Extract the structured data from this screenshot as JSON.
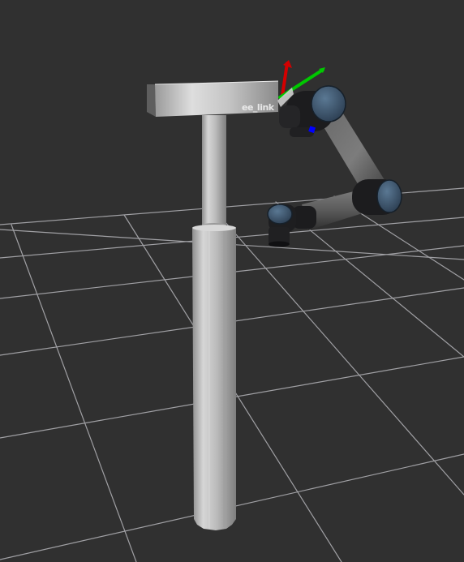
{
  "scene": {
    "background_color": "#303030",
    "grid_color": "#a0a0a4",
    "pedestal_color": "#c8c8c8",
    "arm_link_color": "#5a5a5a",
    "arm_joint_color": "#1c1c1e",
    "joint_cap_color": "#3f5870",
    "axis_colors": {
      "x": "#d40000",
      "y": "#00c800",
      "z": "#0000ff"
    },
    "tf_frame_label": "ee_link"
  }
}
